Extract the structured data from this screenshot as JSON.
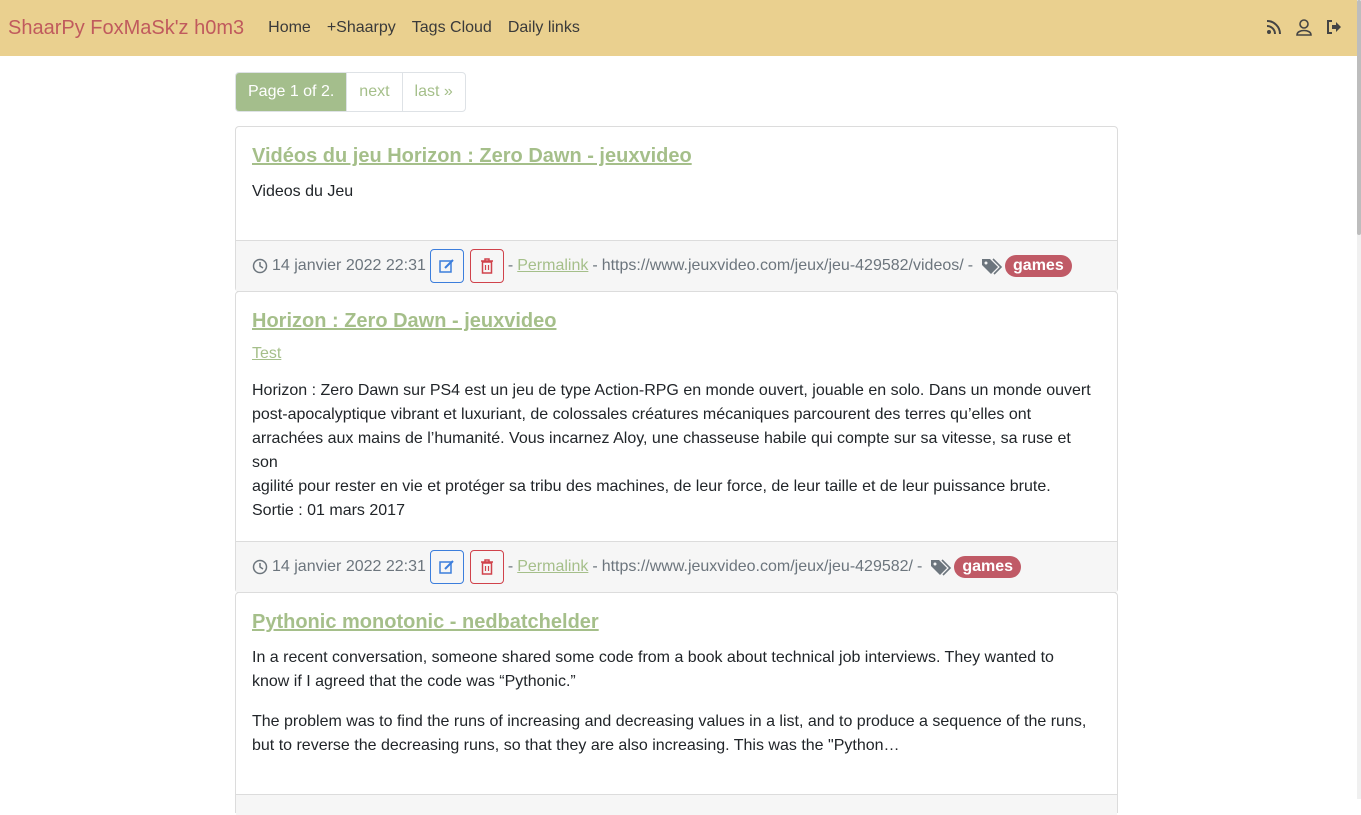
{
  "nav": {
    "brand": "ShaarPy FoxMaSk'z h0m3",
    "links": [
      "Home",
      "+Shaarpy",
      "Tags Cloud",
      "Daily links"
    ]
  },
  "pagination": {
    "current": "Page 1 of 2.",
    "next": "next",
    "last": "last »"
  },
  "colors": {
    "navbar": "#ead08f",
    "brand": "#c05a5d",
    "accent_green": "#a5bf8a",
    "tag_badge": "#c05a66",
    "edit_blue": "#3c7edc",
    "delete_red": "#d0424b"
  },
  "links": [
    {
      "title": "Vidéos du jeu Horizon : Zero Dawn - jeuxvideo",
      "text": "Videos du Jeu",
      "date": "14 janvier 2022 22:31",
      "permalink": "Permalink",
      "url": "https://www.jeuxvideo.com/jeux/jeu-429582/videos/",
      "tag": "games"
    },
    {
      "title": "Horizon : Zero Dawn - jeuxvideo",
      "tagline": "Test",
      "text_lines": [
        "Horizon : Zero Dawn sur PS4 est un jeu de type Action-RPG en monde ouvert, jouable en solo. Dans un monde ouvert",
        "post-apocalyptique vibrant et luxuriant, de colossales créatures mécaniques parcourent des terres qu’elles ont",
        "arrachées aux mains de l’humanité. Vous incarnez Aloy, une chasseuse habile qui compte sur sa vitesse, sa ruse et son",
        "agilité pour rester en vie et protéger sa tribu des machines, de leur force, de leur taille et de leur puissance brute.",
        "Sortie : 01 mars 2017"
      ],
      "date": "14 janvier 2022 22:31",
      "permalink": "Permalink",
      "url": "https://www.jeuxvideo.com/jeux/jeu-429582/",
      "tag": "games"
    },
    {
      "title": "Pythonic monotonic - nedbatchelder",
      "para1_lines": [
        "In a recent conversation, someone shared some code from a book about technical job interviews. They wanted to",
        "know if I agreed that the code was “Pythonic.”"
      ],
      "para2_lines": [
        "The problem was to find the runs of increasing and decreasing values in a list, and to produce a sequence of the runs,",
        "but to reverse the decreasing runs, so that they are also increasing. This was the \"Python…"
      ]
    }
  ]
}
